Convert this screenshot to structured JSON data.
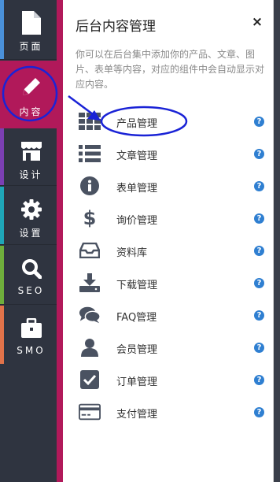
{
  "sidebar": {
    "items": [
      {
        "id": "page",
        "label": "页面",
        "icon": "page-icon",
        "stripe": "#4a90d9"
      },
      {
        "id": "content",
        "label": "内容",
        "icon": "pencil-icon",
        "stripe": "#b1195a",
        "active": true
      },
      {
        "id": "design",
        "label": "设计",
        "icon": "store-icon",
        "stripe": "#7b3fb3"
      },
      {
        "id": "settings",
        "label": "设置",
        "icon": "gear-icon",
        "stripe": "#1fa6b8"
      },
      {
        "id": "seo",
        "label": "SEO",
        "icon": "search-icon",
        "stripe": "#6fae3c"
      },
      {
        "id": "smo",
        "label": "SMO",
        "icon": "briefcase-icon",
        "stripe": "#e2734a"
      }
    ]
  },
  "panel": {
    "title": "后台内容管理",
    "close": "×",
    "description": "你可以在后台集中添加你的产品、文章、图片、表单等内容，对应的组件中会自动显示对应内容。"
  },
  "menu": {
    "help_glyph": "?",
    "items": [
      {
        "label": "产品管理",
        "icon": "grid-icon"
      },
      {
        "label": "文章管理",
        "icon": "list-icon"
      },
      {
        "label": "表单管理",
        "icon": "info-icon"
      },
      {
        "label": "询价管理",
        "icon": "dollar-icon"
      },
      {
        "label": "资料库",
        "icon": "inbox-icon"
      },
      {
        "label": "下载管理",
        "icon": "download-icon"
      },
      {
        "label": "FAQ管理",
        "icon": "comments-icon"
      },
      {
        "label": "会员管理",
        "icon": "user-icon"
      },
      {
        "label": "订单管理",
        "icon": "checkbox-icon"
      },
      {
        "label": "支付管理",
        "icon": "credit-card-icon"
      }
    ]
  },
  "colors": {
    "accent": "#b1195a",
    "help": "#2f7fd1",
    "annotation": "#1a23d6"
  }
}
